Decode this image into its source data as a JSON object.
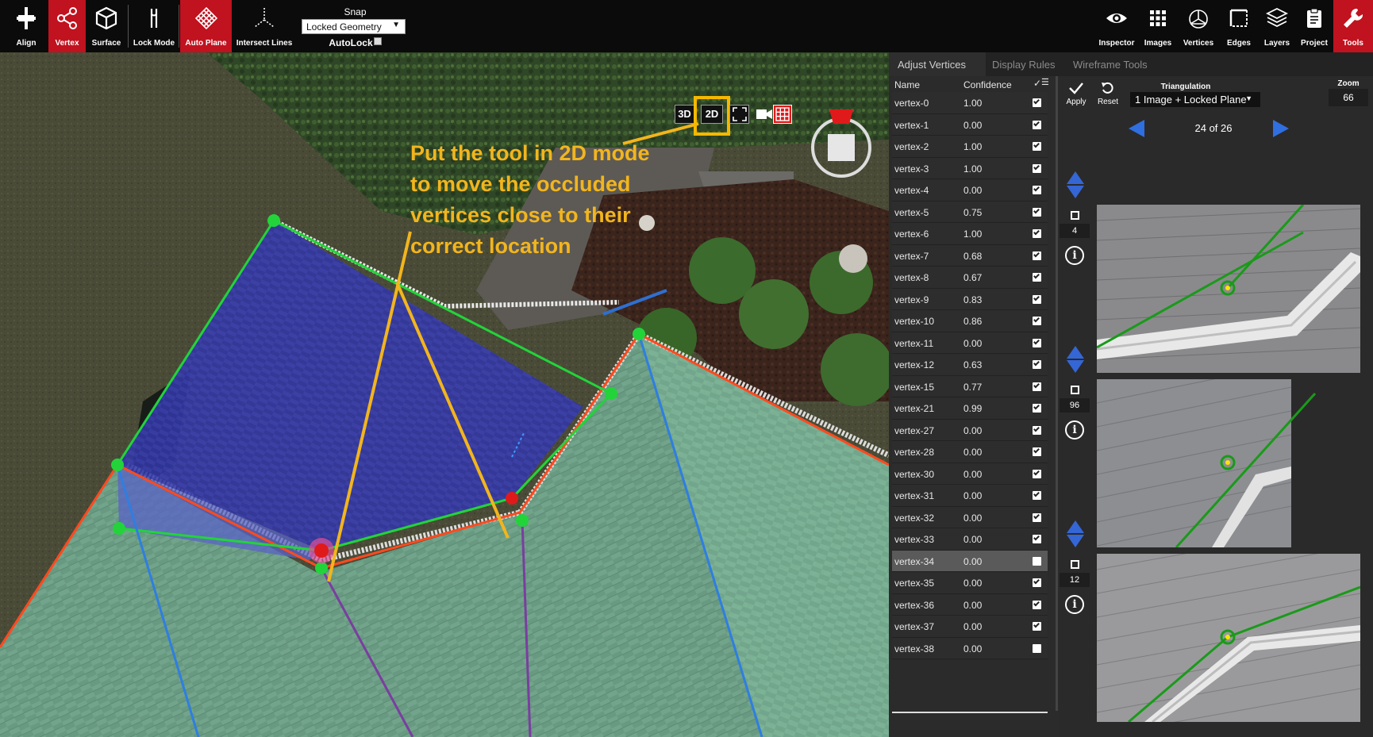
{
  "toolbar": {
    "left_tools": [
      {
        "label": "Align",
        "icon": "align-icon",
        "active": false
      },
      {
        "label": "Vertex",
        "icon": "vertex-icon",
        "active": true
      },
      {
        "label": "Surface",
        "icon": "surface-icon",
        "active": false
      },
      {
        "label": "Lock Mode",
        "icon": "lock-mode-icon",
        "active": false
      },
      {
        "label": "Auto Plane",
        "icon": "auto-plane-icon",
        "active": true
      },
      {
        "label": "Intersect Lines",
        "icon": "intersect-lines-icon",
        "active": false
      }
    ],
    "snap": {
      "label": "Snap",
      "value": "Locked Geometry",
      "autolock_label": "AutoLock",
      "autolock_checked": false
    },
    "right_tools": [
      {
        "label": "Inspector",
        "icon": "eye-icon",
        "active": false
      },
      {
        "label": "Images",
        "icon": "images-grid-icon",
        "active": false
      },
      {
        "label": "Vertices",
        "icon": "vertices-icon",
        "active": false
      },
      {
        "label": "Edges",
        "icon": "edges-icon",
        "active": false
      },
      {
        "label": "Layers",
        "icon": "layers-icon",
        "active": false
      },
      {
        "label": "Project",
        "icon": "clipboard-icon",
        "active": false
      },
      {
        "label": "Tools",
        "icon": "wrench-icon",
        "active": true
      }
    ]
  },
  "viewport": {
    "view_buttons": {
      "three_d": "3D",
      "two_d": "2D"
    },
    "annotation": "Put the tool in 2D mode\nto move the occluded\nvertices close to their\ncorrect location",
    "colors": {
      "annotation": "#f2b51d",
      "selected_plane": "#2b34c8",
      "roof": "#7fb39a",
      "edge_green": "#22d43a",
      "edge_red": "#ff4a1f",
      "edge_blue": "#2f7ee0",
      "edge_purple": "#7a3ea0"
    }
  },
  "panel": {
    "tabs": [
      "Adjust Vertices",
      "Display Rules",
      "Wireframe Tools"
    ],
    "active_tab": 0,
    "table": {
      "headers": {
        "name": "Name",
        "confidence": "Confidence"
      },
      "rows": [
        {
          "name": "vertex-0",
          "confidence": "1.00",
          "checked": true
        },
        {
          "name": "vertex-1",
          "confidence": "0.00",
          "checked": true
        },
        {
          "name": "vertex-2",
          "confidence": "1.00",
          "checked": true
        },
        {
          "name": "vertex-3",
          "confidence": "1.00",
          "checked": true
        },
        {
          "name": "vertex-4",
          "confidence": "0.00",
          "checked": true
        },
        {
          "name": "vertex-5",
          "confidence": "0.75",
          "checked": true
        },
        {
          "name": "vertex-6",
          "confidence": "1.00",
          "checked": true
        },
        {
          "name": "vertex-7",
          "confidence": "0.68",
          "checked": true
        },
        {
          "name": "vertex-8",
          "confidence": "0.67",
          "checked": true
        },
        {
          "name": "vertex-9",
          "confidence": "0.83",
          "checked": true
        },
        {
          "name": "vertex-10",
          "confidence": "0.86",
          "checked": true
        },
        {
          "name": "vertex-11",
          "confidence": "0.00",
          "checked": true
        },
        {
          "name": "vertex-12",
          "confidence": "0.63",
          "checked": true
        },
        {
          "name": "vertex-15",
          "confidence": "0.77",
          "checked": true
        },
        {
          "name": "vertex-21",
          "confidence": "0.99",
          "checked": true
        },
        {
          "name": "vertex-27",
          "confidence": "0.00",
          "checked": true
        },
        {
          "name": "vertex-28",
          "confidence": "0.00",
          "checked": true
        },
        {
          "name": "vertex-30",
          "confidence": "0.00",
          "checked": true
        },
        {
          "name": "vertex-31",
          "confidence": "0.00",
          "checked": true
        },
        {
          "name": "vertex-32",
          "confidence": "0.00",
          "checked": true
        },
        {
          "name": "vertex-33",
          "confidence": "0.00",
          "checked": true
        },
        {
          "name": "vertex-34",
          "confidence": "0.00",
          "checked": false,
          "selected": true
        },
        {
          "name": "vertex-35",
          "confidence": "0.00",
          "checked": true
        },
        {
          "name": "vertex-36",
          "confidence": "0.00",
          "checked": true
        },
        {
          "name": "vertex-37",
          "confidence": "0.00",
          "checked": true
        },
        {
          "name": "vertex-38",
          "confidence": "0.00",
          "checked": false
        }
      ]
    },
    "image_panel": {
      "apply_label": "Apply",
      "reset_label": "Reset",
      "triangulation_label": "Triangulation",
      "triangulation_value": "1 Image + Locked Plane",
      "zoom_label": "Zoom",
      "zoom_value": "66",
      "nav_count": "24 of 26",
      "thumbnails": [
        {
          "count": "4"
        },
        {
          "count": "96"
        },
        {
          "count": "12"
        }
      ]
    }
  }
}
